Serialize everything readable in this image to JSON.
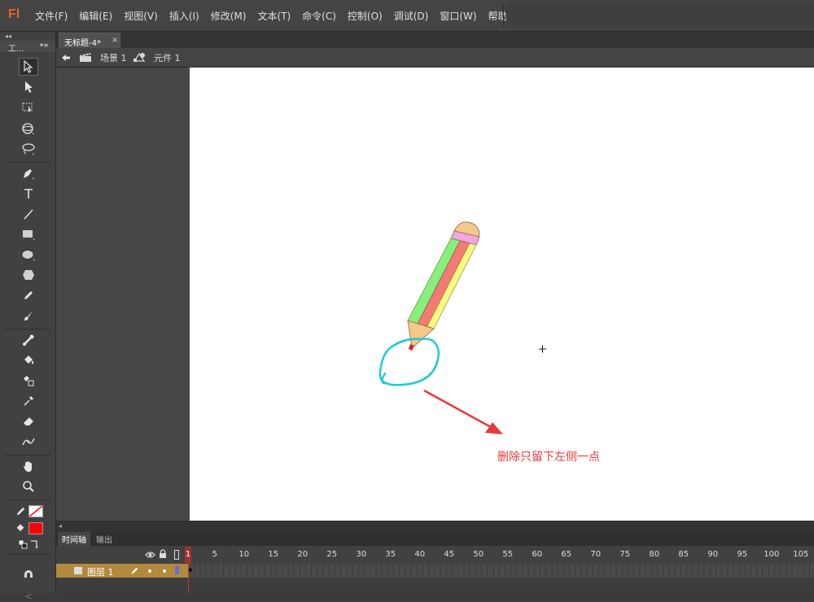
{
  "app": {
    "logo": "Fl"
  },
  "menu": [
    "文件(F)",
    "编辑(E)",
    "视图(V)",
    "插入(I)",
    "修改(M)",
    "文本(T)",
    "命令(C)",
    "控制(O)",
    "调试(D)",
    "窗口(W)",
    "帮助(H)"
  ],
  "tools_panel": {
    "title": "工...",
    "tools": [
      "selection-tool-icon",
      "subselection-tool-icon",
      "free-transform-tool-icon",
      "3d-rotation-tool-icon",
      "lasso-tool-icon",
      "pen-tool-icon",
      "text-tool-icon",
      "line-tool-icon",
      "rectangle-tool-icon",
      "oval-tool-icon",
      "polystar-tool-icon",
      "pencil-tool-icon",
      "brush-tool-icon",
      "bone-tool-icon",
      "paint-bucket-tool-icon",
      "ink-bottle-tool-icon",
      "eyedropper-tool-icon",
      "eraser-tool-icon",
      "width-tool-icon",
      "hand-tool-icon",
      "zoom-tool-icon"
    ],
    "stroke_color": "none",
    "fill_color": "#ff0000"
  },
  "document_tab": {
    "label": "无标题-4*",
    "close": "×"
  },
  "edit_bar": {
    "scene": "场景 1",
    "symbol": "元件 1"
  },
  "annotation": {
    "text": "删除只留下左侧一点",
    "color": "#e53a3a"
  },
  "timeline": {
    "tabs": [
      "时间轴",
      "输出"
    ],
    "current_frame": "1",
    "ruler_labels": [
      "5",
      "10",
      "15",
      "20",
      "25",
      "30",
      "35",
      "40",
      "45",
      "50",
      "55",
      "60",
      "65",
      "70",
      "75",
      "80",
      "85",
      "90",
      "95",
      "100",
      "105"
    ],
    "layer_name": "图层 1"
  },
  "colors": {
    "accent": "#e8632a",
    "layer_highlight": "#b3893d",
    "pencil_green": "#86f07a",
    "pencil_red": "#f47a74",
    "pencil_yellow": "#fdf97e",
    "eraser_pink": "#f4a3e6",
    "circle_stroke": "#21c9d6"
  }
}
